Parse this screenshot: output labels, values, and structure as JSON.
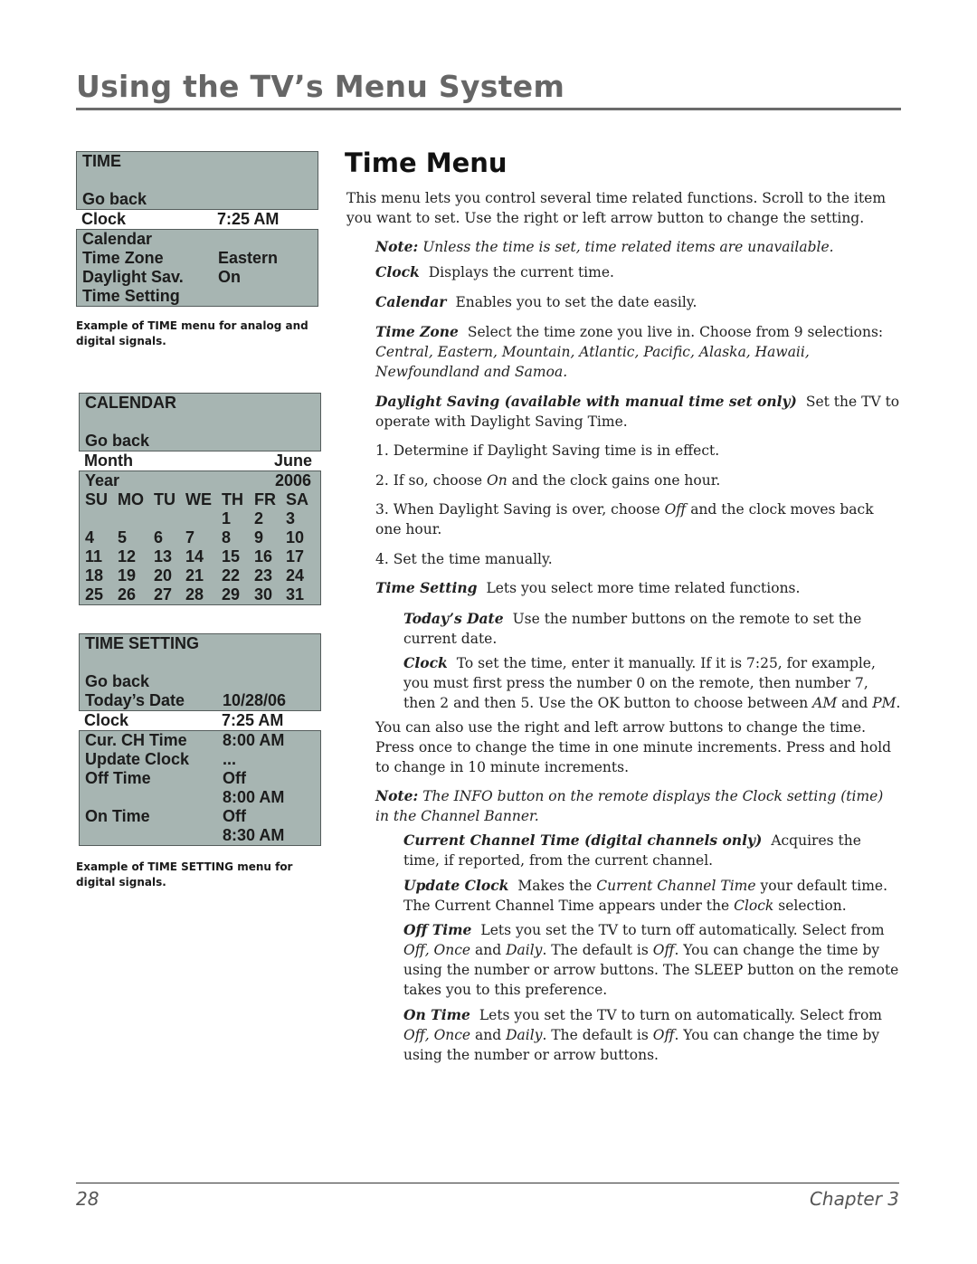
{
  "header": {
    "title": "Using the TV’s Menu System"
  },
  "time_menu": {
    "title": "TIME",
    "rows": [
      {
        "label": "Go back",
        "value": ""
      },
      {
        "label": "Clock",
        "value": "7:25 AM",
        "selected": true
      },
      {
        "label": "Calendar",
        "value": ""
      },
      {
        "label": "Time Zone",
        "value": "Eastern"
      },
      {
        "label": "Daylight Sav.",
        "value": "On"
      },
      {
        "label": "Time Setting",
        "value": ""
      }
    ],
    "caption": "Example of TIME menu for analog and digital signals."
  },
  "calendar_menu": {
    "title": "CALENDAR",
    "go_back": "Go back",
    "month_label": "Month",
    "month_value": "June",
    "year_label": "Year",
    "year_value": "2006",
    "weekdays": [
      "SU",
      "MO",
      "TU",
      "WE",
      "TH",
      "FR",
      "SA"
    ],
    "days": [
      "",
      "",
      "",
      "",
      "1",
      "2",
      "3",
      "4",
      "5",
      "6",
      "7",
      "8",
      "9",
      "10",
      "11",
      "12",
      "13",
      "14",
      "15",
      "16",
      "17",
      "18",
      "19",
      "20",
      "21",
      "22",
      "23",
      "24",
      "25",
      "26",
      "27",
      "28",
      "29",
      "30",
      "31"
    ]
  },
  "time_setting_menu": {
    "title": "TIME SETTING",
    "rows": [
      {
        "label": "Go back",
        "value": ""
      },
      {
        "label": "Today’s Date",
        "value": "10/28/06"
      },
      {
        "label": "Clock",
        "value": "7:25 AM",
        "selected": true
      },
      {
        "label": "Cur. CH Time",
        "value": "8:00 AM"
      },
      {
        "label": "Update Clock",
        "value": "..."
      },
      {
        "label": "Off Time",
        "value": "Off"
      },
      {
        "label": "",
        "value": "8:00 AM"
      },
      {
        "label": "On Time",
        "value": "Off"
      },
      {
        "label": "",
        "value": "8:30 AM"
      }
    ],
    "caption": "Example of TIME SETTING menu for digital signals."
  },
  "content": {
    "section_title": "Time Menu",
    "intro": "This menu lets you control several time related functions. Scroll to the item you want to set. Use the right or left arrow button to change the setting.",
    "note1_label": "Note:",
    "note1_text": "Unless the time is set, time related items are unavailable.",
    "clock_term": "Clock",
    "clock_text": "Displays the current time.",
    "calendar_term": "Calendar",
    "calendar_text": "Enables you to set the date easily.",
    "timezone_term": "Time Zone",
    "timezone_text": "Select the time zone you live in. Choose from 9 selections:",
    "timezone_list": "Central, Eastern, Mountain, Atlantic, Pacific, Alaska, Hawaii, Newfoundland and Samoa.",
    "daylight_term": "Daylight Saving (available with manual time set only)",
    "daylight_text": "Set the TV to operate with Daylight Saving Time.",
    "step1": "1. Determine if  Daylight Saving time is in effect.",
    "step2_a": "2. If  so, choose ",
    "step2_em": "On",
    "step2_b": " and the clock gains one hour.",
    "step3_a": "3. When Daylight Saving is over, choose ",
    "step3_em": "Off",
    "step3_b": " and the clock moves back one hour.",
    "step4": "4. Set the time manually.",
    "timesetting_term": "Time Setting",
    "timesetting_text": "Lets you select more time related functions.",
    "todaysdate_term": "Today’s Date",
    "todaysdate_text": "Use the number buttons on the remote to set the current date.",
    "clock2_term": "Clock",
    "clock2_text_a": "To set the time, enter it manually. If  it is 7:25, for example, you must first press the number 0 on the remote, then number 7, then 2 and then 5. Use the OK button to choose between ",
    "clock2_am": "AM",
    "clock2_and": " and ",
    "clock2_pm": "PM",
    "clock2_end": ".",
    "arrows_text": "You can also use the right and left arrow buttons to change the time. Press once to change the time in one minute increments. Press and hold to change in 10 minute increments.",
    "note2_label": "Note:",
    "note2_text": "The INFO button on the remote displays the Clock setting (time) in the Channel Banner.",
    "curch_term": "Current Channel Time (digital channels only)",
    "curch_text": "Acquires the time, if  reported, from the current channel.",
    "update_term": "Update Clock",
    "update_a": "Makes the ",
    "update_em1": "Current Channel Time",
    "update_b": " your default time. The Current Channel Time appears under the ",
    "update_em2": "Clock",
    "update_c": " selection.",
    "offtime_term": "Off Time",
    "offtime_a": "Lets you set the TV to turn off  automatically. Select from ",
    "offtime_opts": "Off, Once",
    "offtime_b": " and ",
    "offtime_daily": "Daily",
    "offtime_c": ". The default is ",
    "offtime_def": "Off",
    "offtime_d": ". You can change the time by using the number or arrow buttons. The SLEEP button on the remote takes you to this preference.",
    "ontime_term": "On Time",
    "ontime_a": "Lets you set the TV to turn on automatically. Select from ",
    "ontime_off": "Off,",
    "ontime_once": "Once",
    "ontime_b": " and ",
    "ontime_daily": "Daily",
    "ontime_c": ". The default is ",
    "ontime_def": "Off",
    "ontime_d": ". You can change the time by using the number or arrow buttons."
  },
  "footer": {
    "page": "28",
    "chapter": "Chapter 3"
  }
}
